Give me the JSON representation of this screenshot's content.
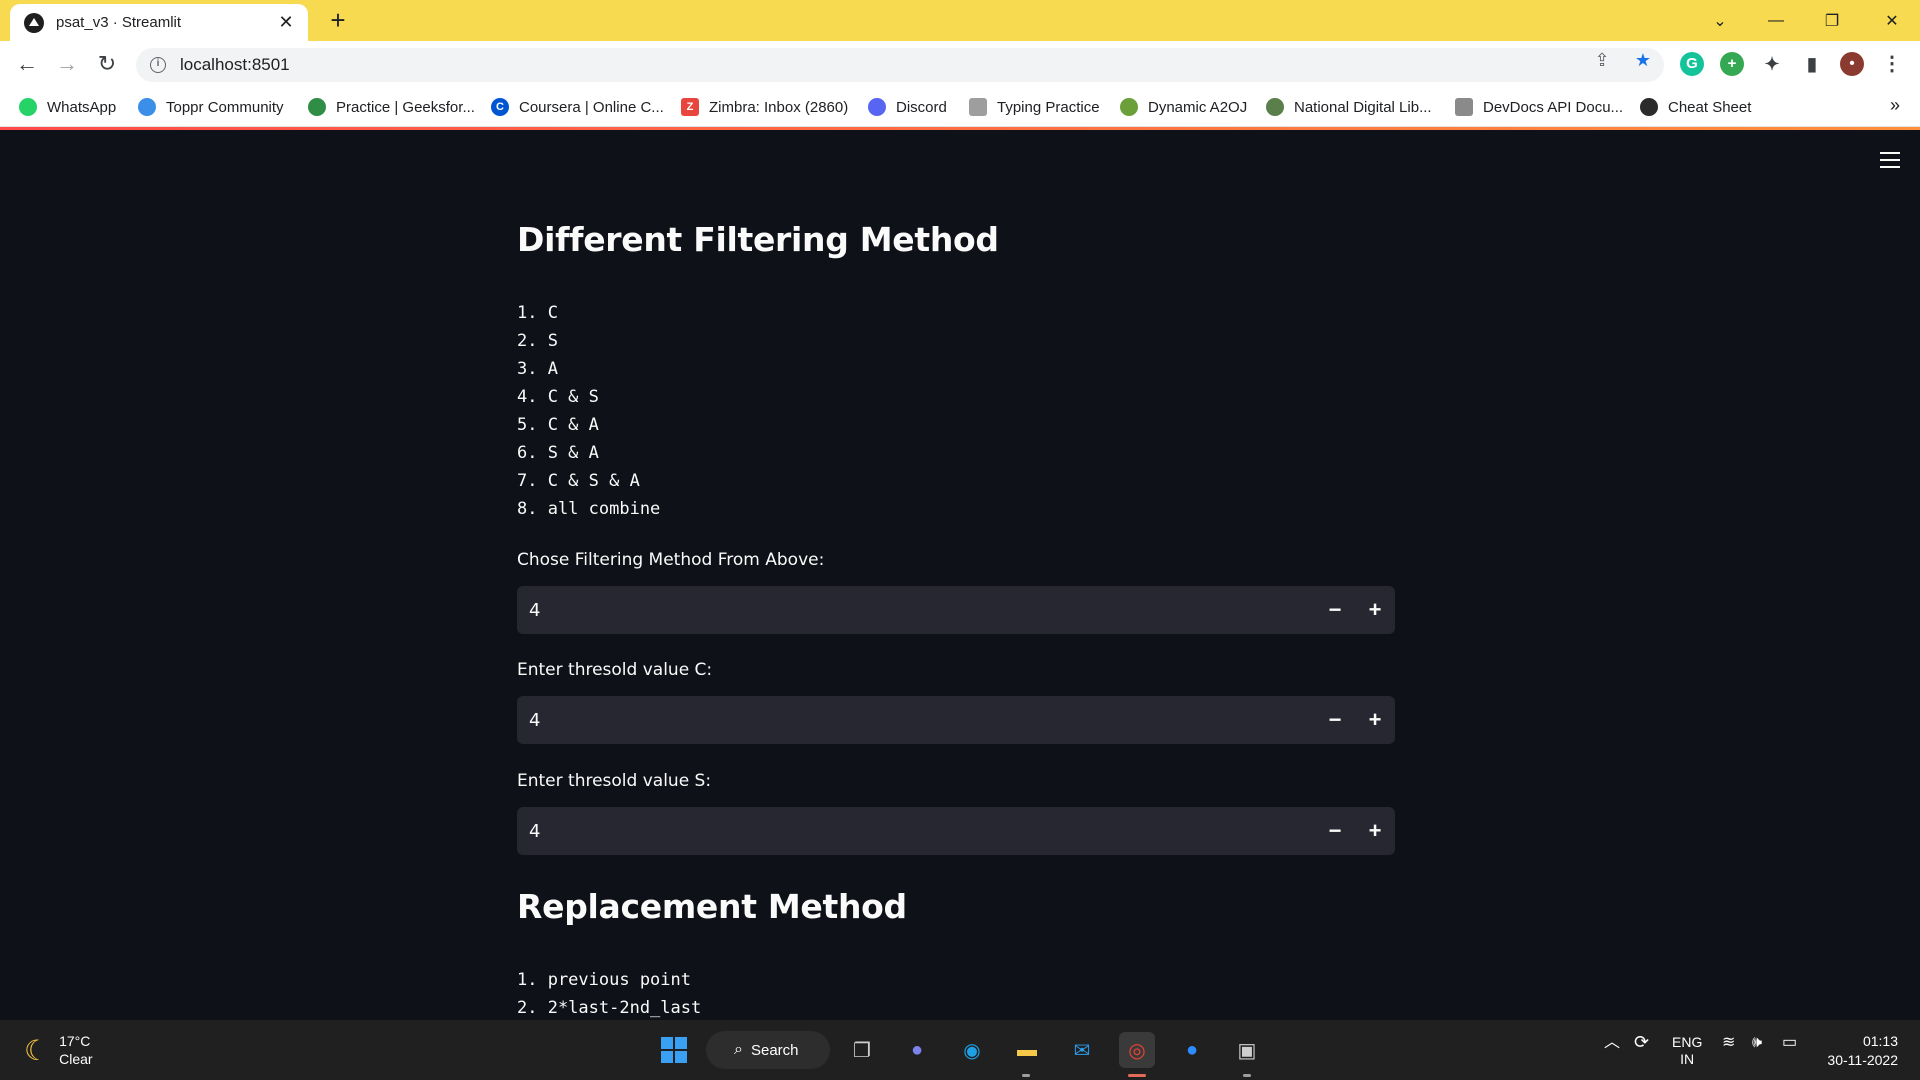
{
  "browser": {
    "tab_title": "psat_v3 · Streamlit",
    "url": "localhost:8501"
  },
  "bookmarks": [
    {
      "label": "WhatsApp",
      "icon": "whatsapp-icon",
      "color": "#25d366"
    },
    {
      "label": "Toppr Community",
      "icon": "toppr-icon",
      "color": "#3b8fe8"
    },
    {
      "label": "Practice | Geeksfor...",
      "icon": "geeksforgeeks-icon",
      "color": "#2f8d46"
    },
    {
      "label": "Coursera | Online C...",
      "icon": "coursera-icon",
      "color": "#0056d2"
    },
    {
      "label": "Zimbra: Inbox (2860)",
      "icon": "zimbra-icon",
      "color": "#e8453c"
    },
    {
      "label": "Discord",
      "icon": "discord-icon",
      "color": "#5865f2"
    },
    {
      "label": "Typing Practice",
      "icon": "typing-icon",
      "color": "#9e9e9e"
    },
    {
      "label": "Dynamic A2OJ",
      "icon": "a2oj-icon",
      "color": "#6a9f3a"
    },
    {
      "label": "National Digital Lib...",
      "icon": "ndl-icon",
      "color": "#5a7f4a"
    },
    {
      "label": "DevDocs API Docu...",
      "icon": "devdocs-icon",
      "color": "#8a8a8a"
    },
    {
      "label": "Cheat Sheet",
      "icon": "cheatsheet-icon",
      "color": "#2b2b2b"
    }
  ],
  "app": {
    "filter_heading": "Different Filtering Method",
    "filter_methods": [
      "1. C",
      "2. S",
      "3. A",
      "4. C & S",
      "5. C & A",
      "6. S & A",
      "7. C & S & A",
      "8. all combine"
    ],
    "inputs": [
      {
        "label": "Chose Filtering Method From Above:",
        "value": "4"
      },
      {
        "label": "Enter thresold value C:",
        "value": "4"
      },
      {
        "label": "Enter thresold value S:",
        "value": "4"
      }
    ],
    "replacement_heading": "Replacement Method",
    "replacement_methods": [
      "1. previous point",
      "2. 2*last-2nd_last"
    ],
    "decrement_label": "−",
    "increment_label": "+"
  },
  "taskbar": {
    "temperature": "17°C",
    "weather": "Clear",
    "search_label": "Search",
    "lang_top": "ENG",
    "lang_bottom": "IN",
    "time": "01:13",
    "date": "30-11-2022"
  }
}
